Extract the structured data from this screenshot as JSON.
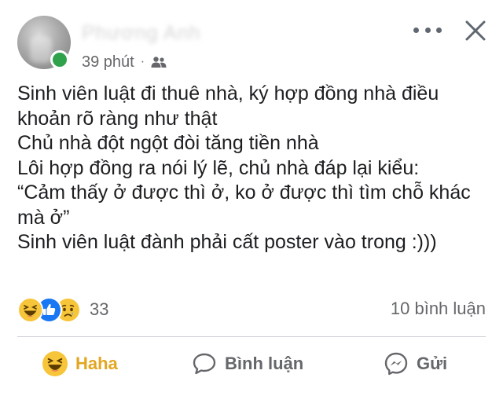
{
  "header": {
    "author_name": "Phương Anh",
    "time": "39 phút",
    "separator": "·",
    "audience_icon": "friends-icon"
  },
  "post": {
    "lines": [
      "Sinh viên luật đi thuê nhà, ký hợp đồng nhà điều",
      "khoản rõ ràng như thật",
      "Chủ nhà đột ngột đòi tăng tiền nhà",
      "Lôi hợp đồng ra nói lý lẽ, chủ nhà đáp lại kiểu:",
      "“Cảm thấy ở được thì ở, ko ở được thì tìm chỗ khác",
      "mà ở”",
      "Sinh viên luật đành phải cất poster vào trong :)))"
    ]
  },
  "reactions": {
    "icons": [
      "haha-icon",
      "like-icon",
      "sad-icon"
    ],
    "count": "33",
    "comments": "10 bình luận"
  },
  "actions": {
    "haha_label": "Haha",
    "comment_label": "Bình luận",
    "send_label": "Gửi"
  },
  "colors": {
    "online": "#31a24c",
    "haha": "#e3a621",
    "like": "#1877f2",
    "secondary_text": "#65676b"
  }
}
